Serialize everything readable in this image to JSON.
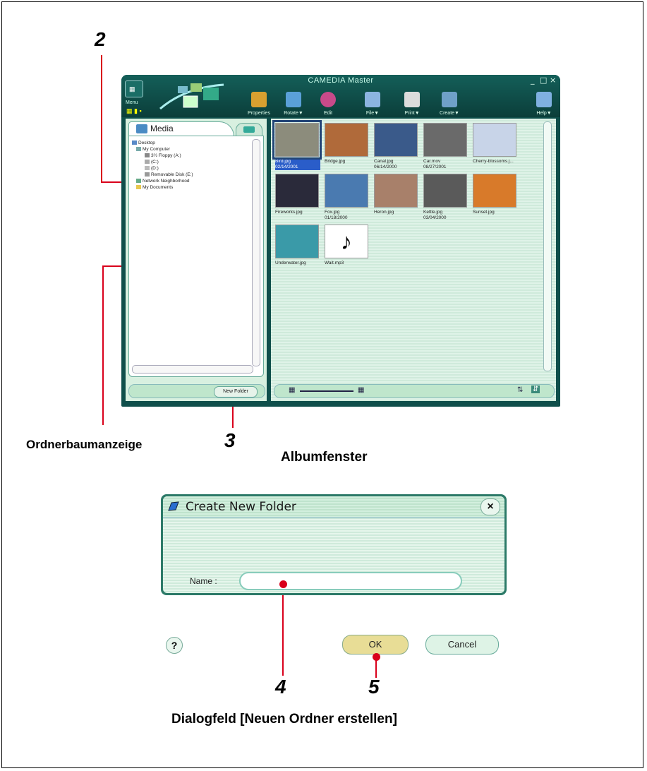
{
  "callouts": {
    "n2": "2",
    "n3": "3",
    "n4": "4",
    "n5": "5"
  },
  "captions": {
    "folder_tree": "Ordnerbaumanzeige",
    "album_window": "Albumfenster",
    "dialog": "Dialogfeld [Neuen Ordner erstellen]"
  },
  "app": {
    "title": "CAMEDIA Master",
    "menu_label": "Menu",
    "window_controls": [
      "_",
      "□",
      "×"
    ],
    "toolbar": [
      {
        "label": "Properties",
        "color": "#d8a030"
      },
      {
        "label": "Rotate▼",
        "color": "#5aa0d8"
      },
      {
        "label": "Edit",
        "color": "#c84a8a"
      },
      {
        "label": "File▼",
        "color": "#8cb4e0"
      },
      {
        "label": "Print▼",
        "color": "#dcdcdc"
      },
      {
        "label": "Create▼",
        "color": "#6fa0c8"
      },
      {
        "label": "Help▼",
        "color": "#7fb0e0"
      }
    ]
  },
  "folder_pane": {
    "tab_label": "Media",
    "tree": [
      {
        "label": "Desktop",
        "level": 0
      },
      {
        "label": "My Computer",
        "level": 1
      },
      {
        "label": "3½ Floppy (A:)",
        "level": 2
      },
      {
        "label": "(C:)",
        "level": 2
      },
      {
        "label": "(D:)",
        "level": 2
      },
      {
        "label": "Removable Disk (E:)",
        "level": 2
      },
      {
        "label": "Network Neighborhood",
        "level": 1
      },
      {
        "label": "My Documents",
        "level": 1
      }
    ],
    "new_folder_button": "New Folder"
  },
  "album": {
    "thumbnails": [
      {
        "name": "Bird.jpg",
        "date": "02/14/2001",
        "selected": true,
        "color": "#8c8c7c"
      },
      {
        "name": "Bridge.jpg",
        "date": "",
        "selected": false,
        "color": "#b06a3a"
      },
      {
        "name": "Canal.jpg",
        "date": "06/14/2000",
        "selected": false,
        "color": "#3a5a8a"
      },
      {
        "name": "Car.mov",
        "date": "08/27/2001",
        "selected": false,
        "color": "#6a6a6a"
      },
      {
        "name": "Cherry-blossoms.j...",
        "date": "",
        "selected": false,
        "color": "#c8d4e8"
      },
      {
        "name": "Fireworks.jpg",
        "date": "",
        "selected": false,
        "color": "#2a2a3a"
      },
      {
        "name": "Fox.jpg",
        "date": "01/18/2000",
        "selected": false,
        "color": "#4a7ab0"
      },
      {
        "name": "Heron.jpg",
        "date": "",
        "selected": false,
        "color": "#a8806a"
      },
      {
        "name": "Kettle.jpg",
        "date": "03/04/2000",
        "selected": false,
        "color": "#5a5a5a"
      },
      {
        "name": "Sunset.jpg",
        "date": "",
        "selected": false,
        "color": "#d87a2a"
      },
      {
        "name": "Underwater.jpg",
        "date": "",
        "selected": false,
        "color": "#3a9aa8"
      },
      {
        "name": "Wait.mp3",
        "date": "",
        "selected": false,
        "color": "#ffffff"
      }
    ]
  },
  "dialog": {
    "title": "Create New Folder",
    "close_label": "×",
    "name_label": "Name :",
    "name_value": "",
    "help_label": "?",
    "ok_label": "OK",
    "cancel_label": "Cancel"
  }
}
